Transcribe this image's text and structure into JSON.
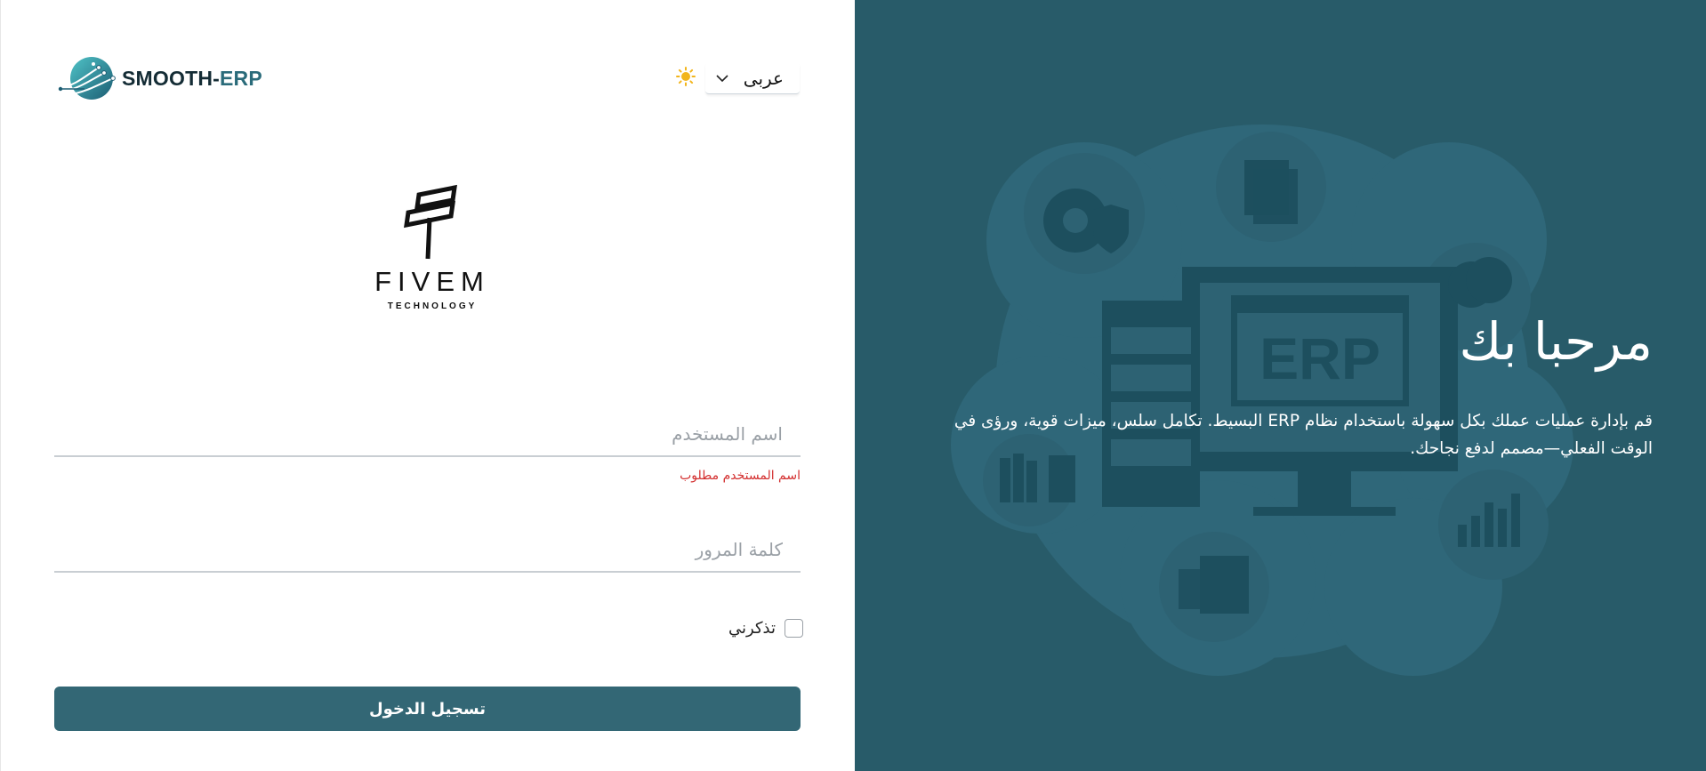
{
  "brand": {
    "name_part1": "SMOOTH-",
    "name_part2": "ERP"
  },
  "language": {
    "selected": "عربى"
  },
  "company": {
    "name": "FIVEM",
    "sub": "TECHNOLOGY"
  },
  "form": {
    "username_placeholder": "اسم المستخدم",
    "username_error": "اسم المستخدم مطلوب",
    "password_placeholder": "كلمة المرور",
    "remember_label": "تذكرني",
    "login_label": "تسجيل الدخول"
  },
  "welcome": {
    "title": "مرحبا بك",
    "description": "قم بإدارة عمليات عملك بكل سهولة باستخدام نظام ERP البسيط. تكامل سلس، ميزات قوية، ورؤى في الوقت الفعلي—مصمم لدفع نجاحك.",
    "illustration_text": "ERP"
  },
  "colors": {
    "panel": "#285b69",
    "button": "#336775",
    "error": "#d32f2f",
    "sun": "#f2b51c"
  },
  "icons": {
    "theme_toggle": "sun-icon",
    "dropdown": "chevron-down-icon"
  }
}
